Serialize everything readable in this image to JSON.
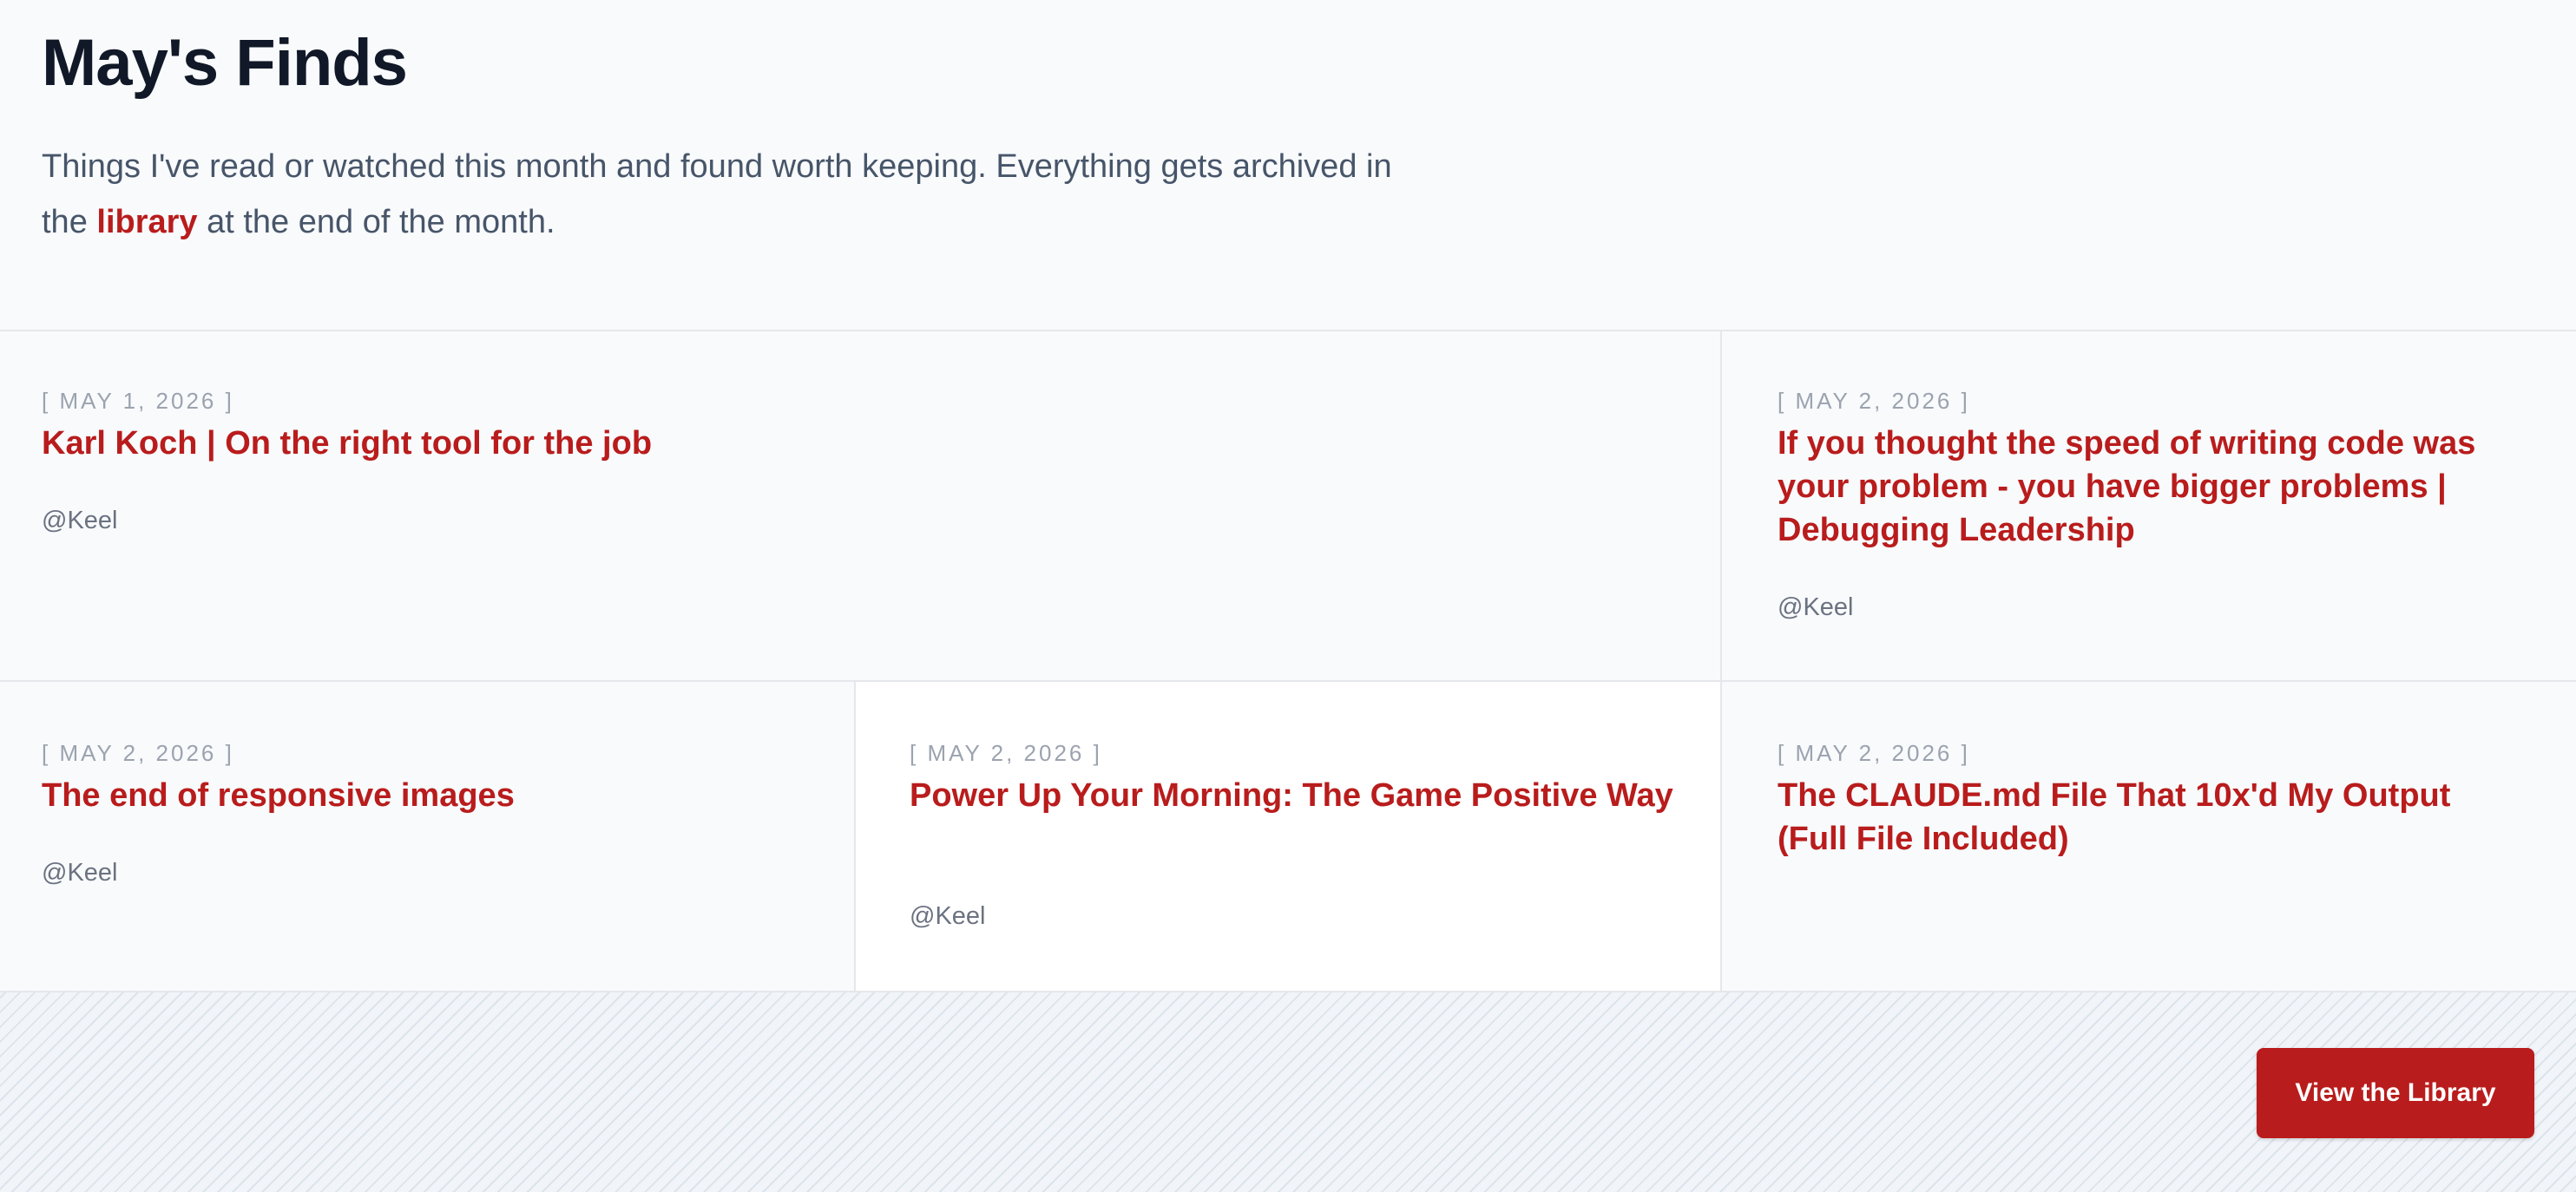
{
  "page": {
    "title": "May's Finds",
    "intro_before": "Things I've read or watched this month and found worth keeping. Everything gets archived in the ",
    "intro_link": "library",
    "intro_after": " at the end of the month."
  },
  "cards": [
    {
      "date": "[ MAY 1, 2026 ]",
      "title": "Karl Koch | On the right tool for the job",
      "author": "@Keel"
    },
    {
      "date": "[ MAY 2, 2026 ]",
      "title": "If you thought the speed of writing code was your problem - you have bigger problems | Debugging Leadership",
      "author": "@Keel"
    },
    {
      "date": "[ MAY 2, 2026 ]",
      "title": "The end of responsive images",
      "author": "@Keel"
    },
    {
      "date": "[ MAY 2, 2026 ]",
      "title": "Power Up Your Morning: The Game Positive Way",
      "author": "@Keel"
    },
    {
      "date": "[ MAY 2, 2026 ]",
      "title": "The CLAUDE.md File That 10x'd My Output (Full File Included)",
      "author": ""
    }
  ],
  "footer": {
    "button_label": "View the Library"
  },
  "colors": {
    "accent": "#b91c1c",
    "background": "#f8fafc",
    "muted_text": "#9ca3af"
  }
}
